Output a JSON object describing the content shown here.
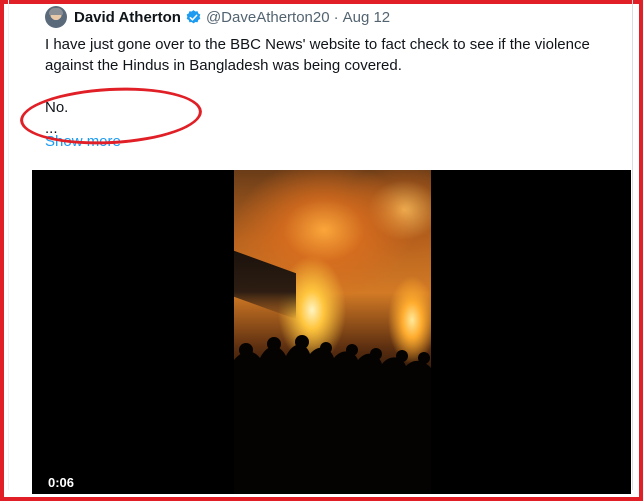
{
  "tweet": {
    "display_name": "David Atherton",
    "handle": "@DaveAtherton20",
    "separator": "·",
    "date": "Aug 12",
    "text_lines": [
      "I have just gone over to the BBC News' website to fact check to see if the violence against the Hindus in Bangladesh was being covered.",
      "No.",
      "..."
    ],
    "show_more": "Show more",
    "verified_color": "#1d9bf0"
  },
  "video": {
    "timestamp": "0:06"
  },
  "annotation": {
    "border_color": "#e01f26"
  }
}
